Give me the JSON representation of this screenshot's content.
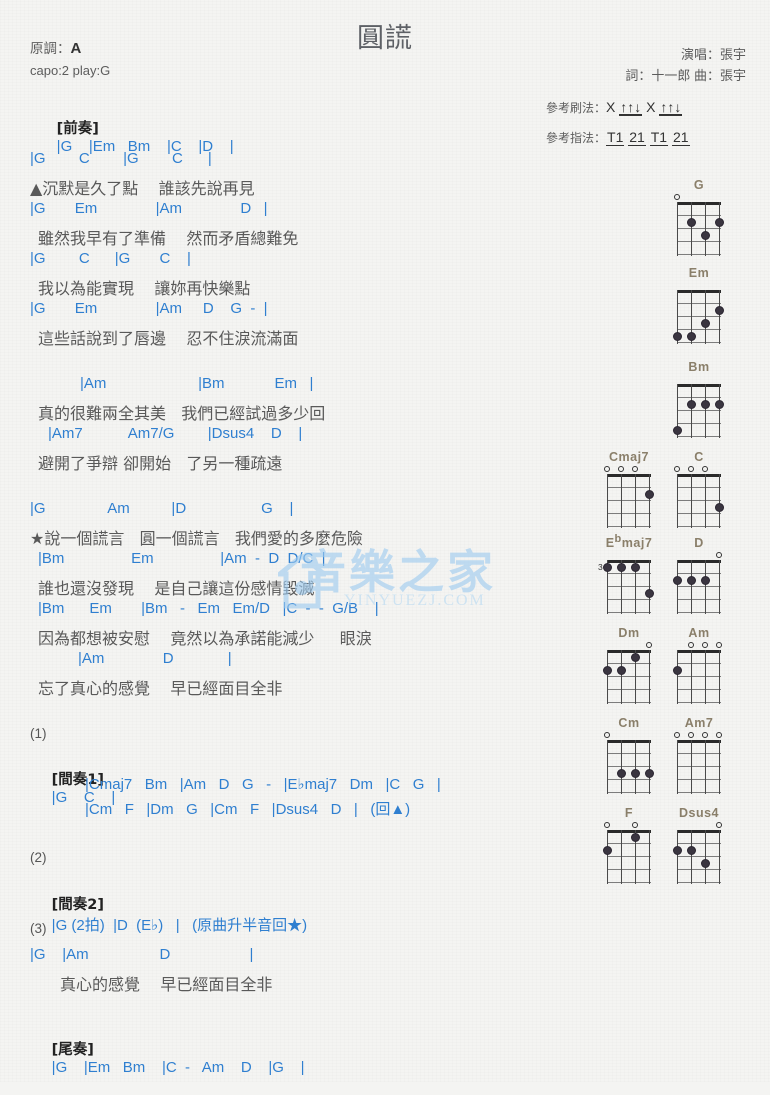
{
  "title": "圓謊",
  "header": {
    "key_label": "原調：",
    "key_value": "A",
    "capo": "capo:2 play:G",
    "singer": "演唱：張宇",
    "credits": "詞：十一郎  曲：張宇",
    "strum_label": "參考刷法：",
    "strum_pattern": "X ↑↑↓ X ↑↑↓",
    "finger_label": "參考指法：",
    "finger_pattern": "T1 21 T1 21"
  },
  "sections": {
    "prelude_label": "[前奏]",
    "prelude_chords": "|G    |Em   Bm    |C    |D    |",
    "interlude1_label": "[間奏1]",
    "interlude2_label": "[間奏2]",
    "outro_label": "[尾奏]",
    "num1": "(1)",
    "num2": "(2)",
    "num3": "(3)"
  },
  "verses": [
    {
      "chords": "|G        C        |G        C      |",
      "lyric": "▲沉默是久了點    誰該先說再見"
    },
    {
      "chords": "|G       Em              |Am              D   |",
      "lyric": "雖然我早有了準備    然而矛盾總難免"
    },
    {
      "chords": "|G        C      |G       C    |",
      "lyric": "我以為能實現    讓妳再快樂點"
    },
    {
      "chords": "|G       Em              |Am     D    G  -  |",
      "lyric": "這些話說到了唇邊    忍不住淚流滿面"
    },
    {
      "chords": "|Am                      |Bm            Em   |",
      "lyric": "真的很難兩全其美   我們已經試過多少回"
    },
    {
      "chords": "|Am7           Am7/G        |Dsus4    D    |",
      "lyric": "避開了爭辯 卻開始   了另一種疏遠"
    },
    {
      "chords": "|G               Am          |D                  G    |",
      "lyric": "★說一個謊言   圓一個謊言   我們愛的多麼危險"
    },
    {
      "chords": "|Bm                Em                |Am  -  D  D/C  |",
      "lyric": "誰也還沒發現    是自己讓這份感情毀滅"
    },
    {
      "chords": "|Bm      Em       |Bm   -   Em   Em/D   |C  -  -  G/B    |",
      "lyric": "因為都想被安慰    竟然以為承諾能減少     眼淚"
    },
    {
      "chords": "|Am              D             |",
      "lyric": "忘了真心的感覺    早已經面目全非"
    }
  ],
  "interlude1": {
    "line1": "|G    C    |",
    "line2": "|Cmaj7   Bm   |Am   D   G   -   |E♭maj7   Dm   |C   G   |",
    "line3": "|Cm   F   |Dm   G   |Cm   F   |Dsus4   D   |   (回▲)"
  },
  "interlude2": {
    "line1": "|G (2拍)  |D  (E♭)   |   (原曲升半音回★)"
  },
  "ending": {
    "chords": "|G    |Am                 D                   |",
    "lyric": "真心的感覺    早已經面目全非",
    "outro_chords": "|G    |Em   Bm    |C  -   Am    D    |G    |"
  },
  "chord_diagrams": [
    {
      "name": "G",
      "open": [
        1
      ],
      "dots": [
        {
          "s": 2,
          "f": 2
        },
        {
          "s": 4,
          "f": 2
        },
        {
          "s": 3,
          "f": 3
        }
      ],
      "base": ""
    },
    {
      "name": "Em",
      "open": [],
      "dots": [
        {
          "s": 4,
          "f": 2
        },
        {
          "s": 3,
          "f": 3
        },
        {
          "s": 1,
          "f": 4
        },
        {
          "s": 2,
          "f": 4
        }
      ],
      "base": ""
    },
    {
      "name": "Bm",
      "open": [],
      "dots": [
        {
          "s": 2,
          "f": 2
        },
        {
          "s": 3,
          "f": 2
        },
        {
          "s": 4,
          "f": 2
        },
        {
          "s": 1,
          "f": 4
        }
      ],
      "base": ""
    },
    {
      "name": "Cmaj7",
      "open": [
        1,
        2,
        3
      ],
      "dots": [
        {
          "s": 4,
          "f": 2
        }
      ],
      "base": ""
    },
    {
      "name": "C",
      "open": [
        1,
        2,
        3
      ],
      "dots": [
        {
          "s": 4,
          "f": 3
        }
      ],
      "base": ""
    },
    {
      "name": "Ebmaj7",
      "open": [],
      "dots": [
        {
          "s": 1,
          "f": 1
        },
        {
          "s": 2,
          "f": 1
        },
        {
          "s": 3,
          "f": 1
        },
        {
          "s": 4,
          "f": 3
        }
      ],
      "base": "3"
    },
    {
      "name": "D",
      "open": [
        4
      ],
      "dots": [
        {
          "s": 1,
          "f": 2
        },
        {
          "s": 2,
          "f": 2
        },
        {
          "s": 3,
          "f": 2
        }
      ],
      "base": ""
    },
    {
      "name": "Dm",
      "open": [
        4
      ],
      "dots": [
        {
          "s": 3,
          "f": 1
        },
        {
          "s": 1,
          "f": 2
        },
        {
          "s": 2,
          "f": 2
        }
      ],
      "base": ""
    },
    {
      "name": "Am",
      "open": [
        2,
        3,
        4
      ],
      "dots": [
        {
          "s": 1,
          "f": 2
        }
      ],
      "base": ""
    },
    {
      "name": "Cm",
      "open": [
        1
      ],
      "dots": [
        {
          "s": 2,
          "f": 3
        },
        {
          "s": 3,
          "f": 3
        },
        {
          "s": 4,
          "f": 3
        }
      ],
      "base": ""
    },
    {
      "name": "Am7",
      "open": [
        1,
        2,
        3,
        4
      ],
      "dots": [],
      "base": ""
    },
    {
      "name": "F",
      "open": [
        1,
        3
      ],
      "dots": [
        {
          "s": 3,
          "f": 1
        },
        {
          "s": 1,
          "f": 2
        }
      ],
      "base": ""
    },
    {
      "name": "Dsus4",
      "open": [
        4
      ],
      "dots": [
        {
          "s": 1,
          "f": 2
        },
        {
          "s": 2,
          "f": 2
        },
        {
          "s": 3,
          "f": 3
        }
      ],
      "base": ""
    }
  ],
  "watermark": {
    "text": "音樂之家",
    "sub": "YINYUEZJ.COM"
  },
  "colors": {
    "chord": "#2f7fd0",
    "lyric": "#595959",
    "chord_name": "#8a7f6a",
    "watermark": "#9ecbf0"
  }
}
